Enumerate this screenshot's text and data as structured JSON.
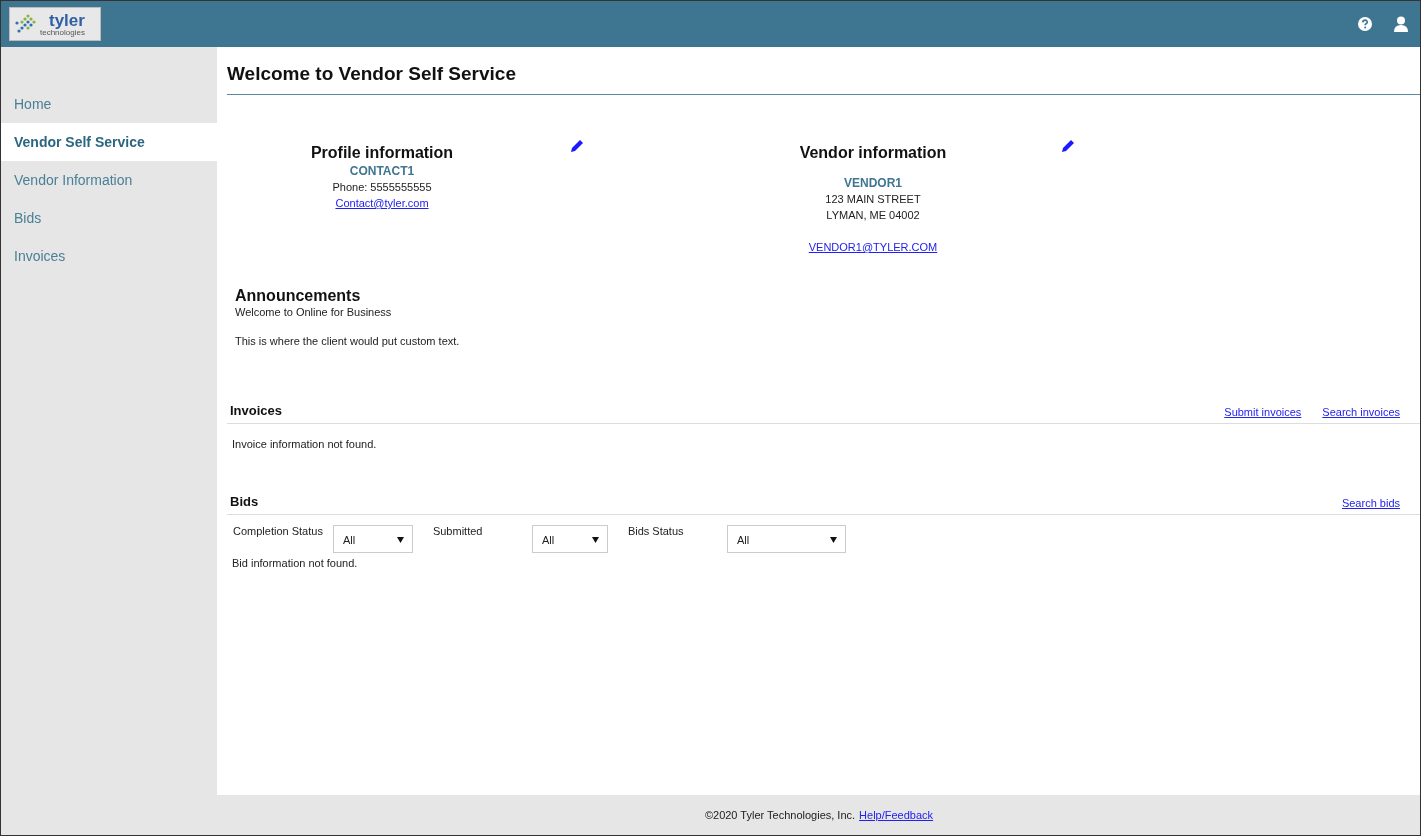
{
  "header": {
    "logo": {
      "name": "tyler",
      "tagline": "technologies"
    }
  },
  "sidebar": {
    "items": [
      {
        "label": "Home",
        "selected": false
      },
      {
        "label": "Vendor Self Service",
        "selected": true
      },
      {
        "label": "Vendor Information",
        "selected": false
      },
      {
        "label": "Bids",
        "selected": false
      },
      {
        "label": "Invoices",
        "selected": false
      }
    ]
  },
  "page_title": "Welcome to Vendor Self Service",
  "cards": [
    {
      "title": "Profile information",
      "name": "CONTACT1",
      "lines": [
        "Phone: 5555555555"
      ],
      "email": "Contact@tyler.com"
    },
    {
      "title": "Vendor information",
      "name": "VENDOR1",
      "lines": [
        "123 MAIN STREET",
        "LYMAN, ME 04002"
      ],
      "email": "VENDOR1@TYLER.COM"
    }
  ],
  "announcements": {
    "title": "Announcements",
    "paragraphs": [
      "Welcome to Online for Business",
      "This is where the client would put custom text."
    ]
  },
  "invoices": {
    "title": "Invoices",
    "links": [
      "Submit invoices",
      "Search invoices"
    ],
    "empty_message": "Invoice information not found."
  },
  "bids": {
    "title": "Bids",
    "links": [
      "Search bids"
    ],
    "filters": [
      {
        "label": "Completion Status",
        "value": "All"
      },
      {
        "label": "Submitted",
        "value": "All"
      },
      {
        "label": "Bids Status",
        "value": "All"
      }
    ],
    "empty_message": "Bid information not found."
  },
  "footer": {
    "copyright": "©2020 Tyler Technologies, Inc.",
    "link": "Help/Feedback"
  }
}
